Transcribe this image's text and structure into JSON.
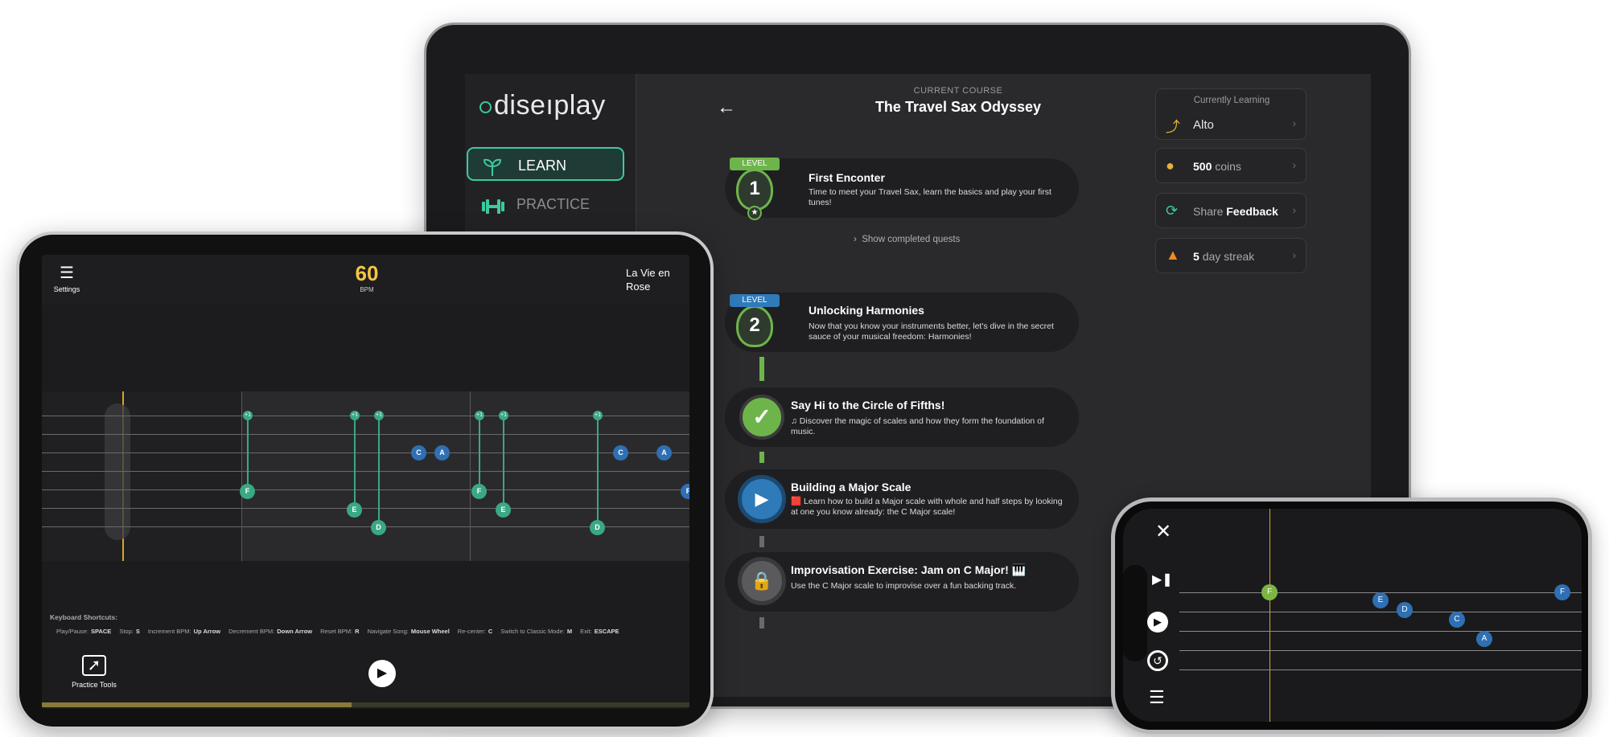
{
  "laptop": {
    "logo": "diseıplay",
    "nav": [
      {
        "label": "LEARN",
        "icon": "sprout-icon"
      },
      {
        "label": "PRACTICE",
        "icon": "dumbbell-icon"
      }
    ],
    "course_label": "CURRENT COURSE",
    "course_title": "The Travel Sax Odyssey",
    "levels": [
      {
        "tag": "LEVEL",
        "number": "1",
        "title": "First Enconter",
        "desc": "Time to meet your Travel Sax, learn the basics and play your first tunes!",
        "tag_color": "#6db54b"
      },
      {
        "tag": "LEVEL",
        "number": "2",
        "title": "Unlocking Harmonies",
        "desc": "Now that you know your instruments better, let's dive in the secret sauce of your musical freedom: Harmonies!",
        "tag_color": "#2f7ab8"
      }
    ],
    "show_completed": "Show completed quests",
    "quests": [
      {
        "title": "Say Hi to the Circle of Fifths!",
        "desc": "♫ Discover the magic of scales and how they form the foundation of music.",
        "status": "completed",
        "icon": "check-icon"
      },
      {
        "title": "Building a Major Scale",
        "desc": "🟥 Learn how to build a Major scale with whole and half steps by looking at one you know already: the C Major scale!",
        "status": "current",
        "icon": "play-icon"
      },
      {
        "title": "Improvisation Exercise: Jam on C Major! 🎹",
        "desc": "Use the C Major scale to improvise over a fun backing track.",
        "status": "locked",
        "icon": "lock-icon"
      }
    ],
    "right_panel": {
      "currently_learning_label": "Currently Learning",
      "instrument": "Alto",
      "coins_value": "500",
      "coins_label": "coins",
      "share_label": "Share",
      "feedback_label": "Feedback",
      "streak_value": "5",
      "streak_label": "day streak"
    }
  },
  "tablet": {
    "settings_label": "Settings",
    "bpm_value": "60",
    "bpm_label": "BPM",
    "song_title": "La Vie en Rose",
    "shortcuts_title": "Keyboard Shortcuts:",
    "shortcuts": [
      {
        "label": "Play/Pause:",
        "key": "SPACE"
      },
      {
        "label": "Stop:",
        "key": "S"
      },
      {
        "label": "Increment BPM:",
        "key": "Up Arrow"
      },
      {
        "label": "Decrement BPM:",
        "key": "Down Arrow"
      },
      {
        "label": "Reset BPM:",
        "key": "R"
      },
      {
        "label": "Navigate Song:",
        "key": "Mouse Wheel"
      },
      {
        "label": "Re-center:",
        "key": "C"
      },
      {
        "label": "Switch to Classic Mode:",
        "key": "M"
      },
      {
        "label": "Exit:",
        "key": "ESCAPE"
      }
    ],
    "practice_tools_label": "Practice Tools",
    "notes": [
      "F",
      "E",
      "D",
      "C",
      "A",
      "F",
      "E",
      "D",
      "C",
      "A",
      "F"
    ],
    "top_marker": "+1"
  },
  "phone": {
    "notes": [
      "F",
      "E",
      "D",
      "C",
      "A",
      "F"
    ]
  },
  "colors": {
    "accent": "#3fc9a0",
    "bpm": "#f5c542",
    "note_green": "#3aa883",
    "note_blue": "#2f6fb4"
  }
}
